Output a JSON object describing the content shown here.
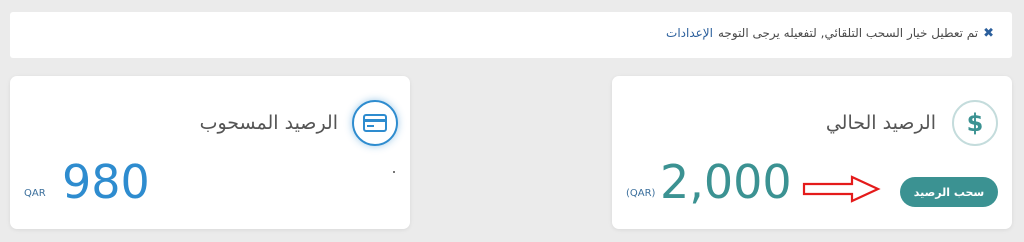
{
  "notice": {
    "close_icon": "✖",
    "message": "تم تعطيل خيار السحب التلقائي, لتفعيله يرجى التوجه",
    "link": "الإعدادات"
  },
  "current_balance": {
    "icon": "$",
    "title": "الرصيد الحالي",
    "amount": "2,000",
    "currency": "(QAR)",
    "button": "سحب الرصيد"
  },
  "withdrawn_balance": {
    "title": "الرصيد المسحوب",
    "amount": "980",
    "currency": "QAR"
  },
  "colors": {
    "teal": "#3b9292",
    "blue": "#2e8ccf",
    "arrow_red": "#e41b1b"
  }
}
